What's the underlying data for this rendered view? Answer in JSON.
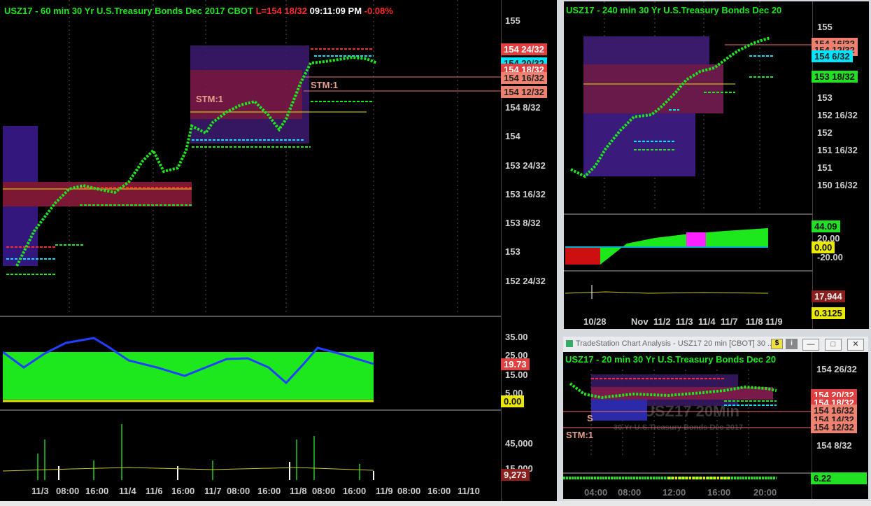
{
  "left_chart": {
    "title_symbol": "USZ17 - 60 min  30 Yr U.S.Treasury Bonds Dec 2017  CBOT",
    "title_last": "L=154 18/32",
    "title_time": "09:11:09 PM",
    "title_change": "-0.08%",
    "price_axis": [
      "155",
      "154 8/32",
      "154",
      "153 24/32",
      "153 16/32",
      "153 8/32",
      "153",
      "152 24/32"
    ],
    "price_tags": {
      "a": "154 24/32",
      "b": "154 20/32",
      "c": "154 18/32",
      "d": "154 16/32",
      "e": "154 12/32"
    },
    "stm_labels": [
      "STM:1",
      "STM:1"
    ],
    "osc_axis": [
      "35.00",
      "25.00",
      "15.00",
      "5.00"
    ],
    "osc_tags": {
      "value": "19.73",
      "zero": "0.00"
    },
    "vol_axis": [
      "45,000",
      "15,000"
    ],
    "vol_tag": "9,273",
    "time_axis": [
      "11/3",
      "08:00",
      "16:00",
      "11/4",
      "11/6",
      "16:00",
      "11/7",
      "08:00",
      "16:00",
      "11/8",
      "08:00",
      "16:00",
      "11/9",
      "08:00",
      "16:00",
      "11/10"
    ]
  },
  "right_top_chart": {
    "title": "USZ17 - 240 min  30 Yr U.S.Treasury Bonds Dec 20",
    "price_axis": [
      "155",
      "153",
      "152 16/32",
      "152",
      "151 16/32",
      "151",
      "150 16/32"
    ],
    "price_tags": {
      "a": "154 16/32",
      "b": "154 12/32",
      "c": "154 6/32",
      "d": "153 18/32"
    },
    "osc_axis": [
      "20.00",
      "-20.00"
    ],
    "osc_tags": {
      "value": "44.09",
      "zero": "0.00"
    },
    "vol_tags": {
      "a": "17,944",
      "b": "0.3125"
    },
    "time_axis": [
      "10/28",
      "Nov",
      "11/2",
      "11/3",
      "11/4",
      "11/7",
      "11/8",
      "11/9"
    ]
  },
  "right_bottom_window": {
    "window_title": "TradeStation Chart Analysis - USZ17 20 min [CBOT] 30 ...",
    "btn_s": "$",
    "btn_i": "i",
    "title": "USZ17 - 20 min  30 Yr U.S.Treasury Bonds Dec 20",
    "watermark_line1": "USZ17 20Min",
    "watermark_line2": "30 Yr U.S.Treasury Bonds Dec 2017",
    "price_axis": [
      "154 26/32",
      "154 8/32"
    ],
    "price_tags": {
      "a": "154 20/32",
      "b": "154 18/32",
      "c": "154 16/32",
      "d": "154 14/32",
      "e": "154 12/32"
    },
    "stm_label": "STM:1",
    "stm_small": "S",
    "osc_tag": "6.22",
    "time_axis": [
      "04:00",
      "08:00",
      "12:00",
      "16:00",
      "20:00"
    ]
  },
  "colors": {
    "up": "#1ce81c",
    "down": "#ff2a2a",
    "neutral": "#c8c8c8",
    "accent": "#00e5ff"
  }
}
